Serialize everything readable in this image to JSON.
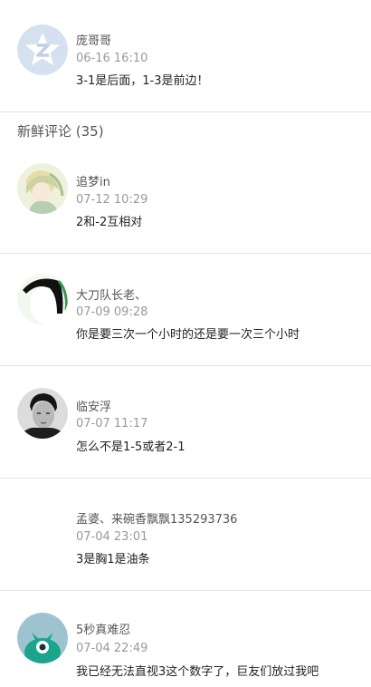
{
  "hot_comment": {
    "username": "庞哥哥",
    "time": "06-16 16:10",
    "content": "3-1是后面，1-3是前边！",
    "avatar_icon": "q-star-logo-icon"
  },
  "section": {
    "title": "新鲜评论 (35)"
  },
  "comments": [
    {
      "username": "追梦in",
      "time": "07-12 10:29",
      "content": "2和-2互相对",
      "avatar_icon": "anime-girl-avatar"
    },
    {
      "username": "大刀队长老、",
      "time": "07-09 09:28",
      "content": "你是要三次一个小时的还是要一次三个小时",
      "avatar_icon": "headband-avatar"
    },
    {
      "username": "临安浮",
      "time": "07-07 11:17",
      "content": "怎么不是1-5或者2-1",
      "avatar_icon": "man-portrait-avatar"
    },
    {
      "username": "孟婆、来碗香飘飘135293736",
      "time": "07-04 23:01",
      "content": "3是胸1是油条",
      "avatar_icon": ""
    },
    {
      "username": "5秒真难忍",
      "time": "07-04 22:49",
      "content": "我已经无法直视3这个数字了，巨友们放过我吧",
      "avatar_icon": "green-monster-avatar"
    }
  ],
  "colors": {
    "username": "#555555",
    "time": "#999999",
    "content": "#222222",
    "divider": "#e5e5e5",
    "q_logo_bg": "#d6e1ef",
    "monster_bg": "#9ec3d0",
    "monster_body": "#1aa58c"
  }
}
